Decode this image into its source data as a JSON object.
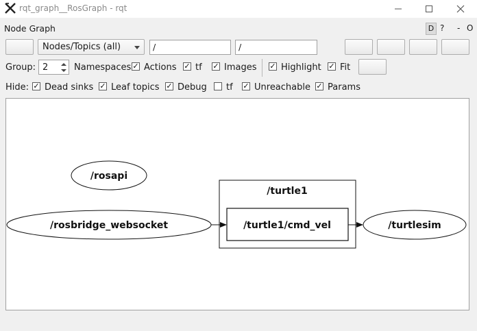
{
  "window": {
    "title": "rqt_graph__RosGraph - rqt",
    "minimize_glyph": "—",
    "maximize_glyph": "☐",
    "close_glyph": "✕"
  },
  "plugin": {
    "title": "Node Graph",
    "d_label": "D",
    "help_label": "?",
    "dash_label": "-",
    "close_label": "O"
  },
  "toolbar": {
    "view_mode": "Nodes/Topics (all)",
    "node_filter": "/",
    "topic_filter": "/"
  },
  "options": {
    "group_label": "Group:",
    "group_value": "2",
    "namespaces_label": "Namespaces",
    "actions": {
      "label": "Actions",
      "checked": true
    },
    "tf": {
      "label": "tf",
      "checked": true
    },
    "images": {
      "label": "Images",
      "checked": true
    },
    "highlight": {
      "label": "Highlight",
      "checked": true
    },
    "fit": {
      "label": "Fit",
      "checked": true
    }
  },
  "hide": {
    "label": "Hide:",
    "dead_sinks": {
      "label": "Dead sinks",
      "checked": true
    },
    "leaf_topics": {
      "label": "Leaf topics",
      "checked": true
    },
    "debug": {
      "label": "Debug",
      "checked": true
    },
    "tf": {
      "label": "tf",
      "checked": false
    },
    "unreachable": {
      "label": "Unreachable",
      "checked": true
    },
    "params": {
      "label": "Params",
      "checked": true
    }
  },
  "graph": {
    "nodes": {
      "rosapi": "/rosapi",
      "rosbridge": "/rosbridge_websocket",
      "turtlesim": "/turtlesim"
    },
    "namespace_box": "/turtle1",
    "topic": "/turtle1/cmd_vel"
  },
  "check_glyph": "✓"
}
